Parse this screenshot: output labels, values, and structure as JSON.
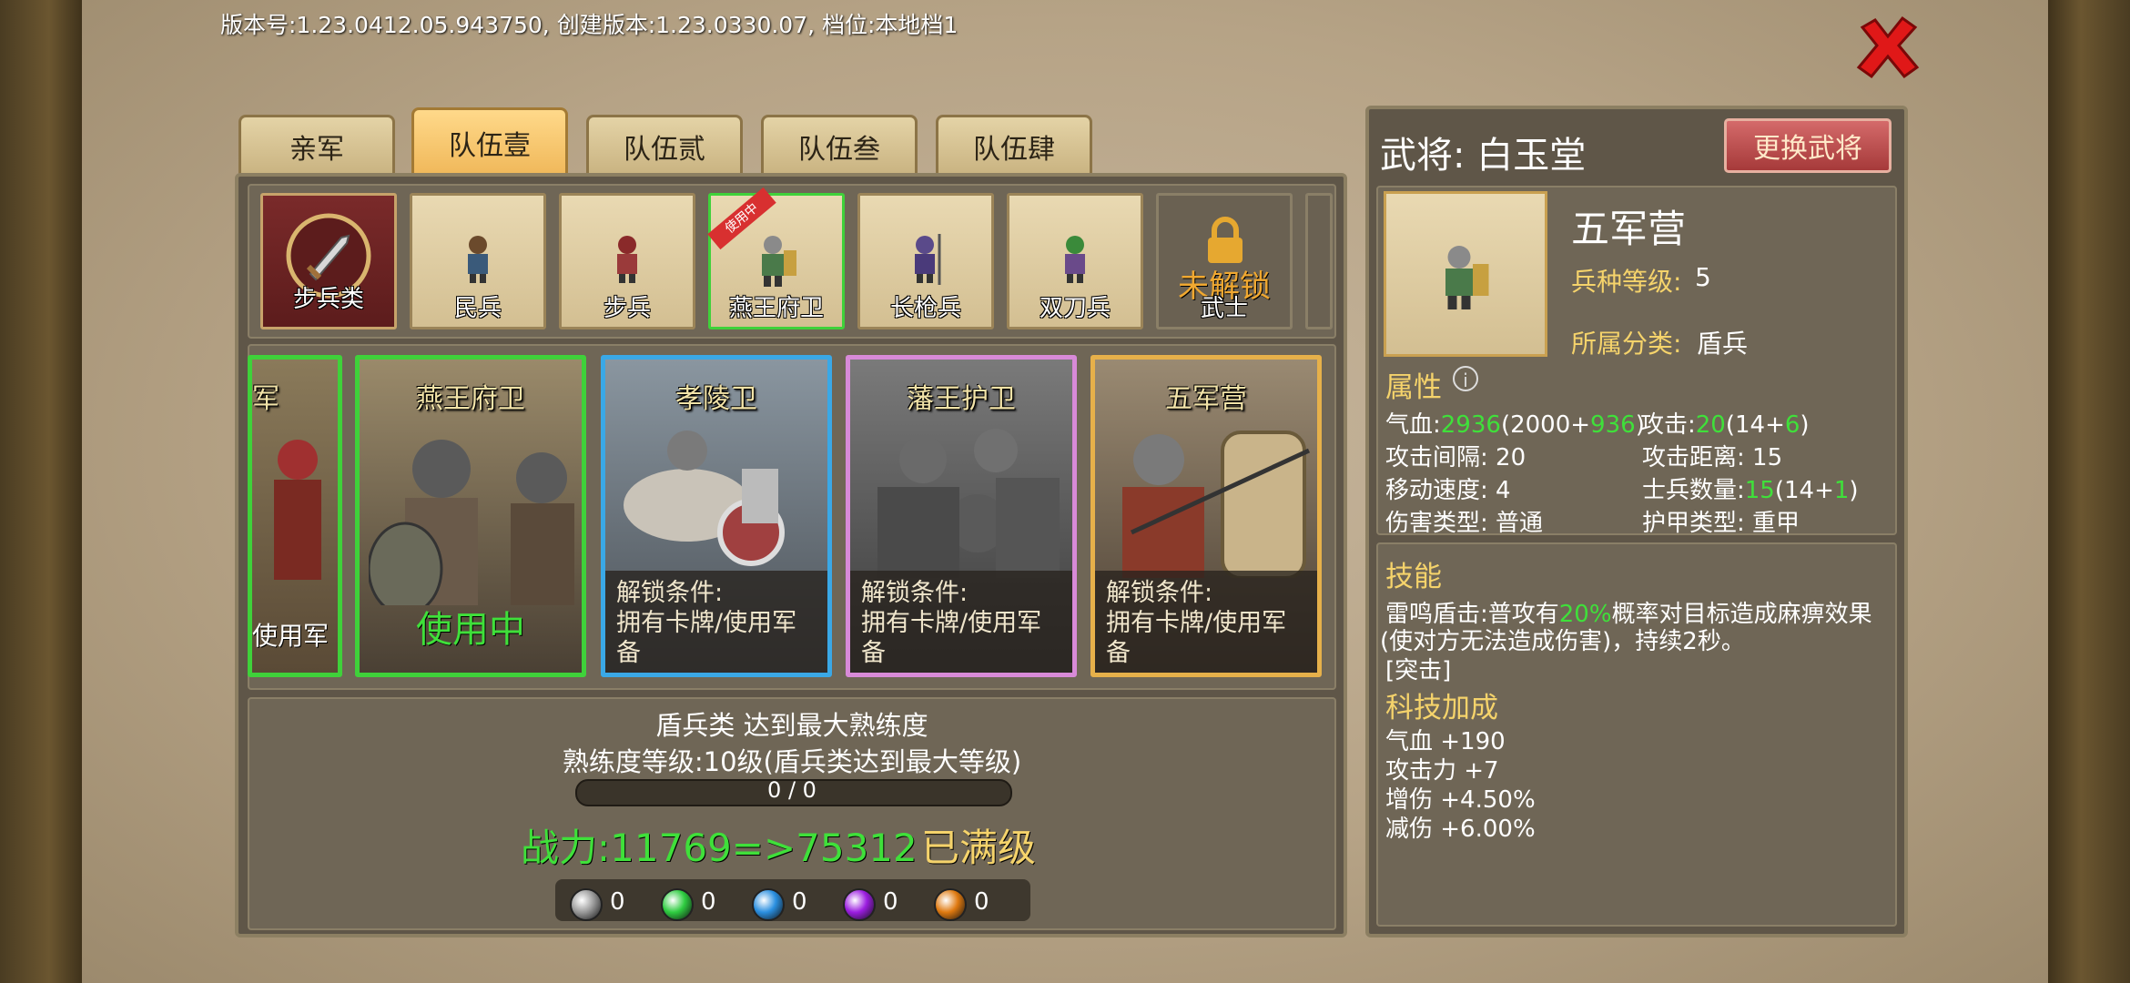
{
  "version_text": "版本号:1.23.0412.05.943750, 创建版本:1.23.0330.07, 档位:本地档1",
  "tabs": [
    "亲军",
    "队伍壹",
    "队伍贰",
    "队伍叁",
    "队伍肆"
  ],
  "active_tab": "队伍壹",
  "unit_slots": [
    {
      "label": "步兵类"
    },
    {
      "label": "民兵"
    },
    {
      "label": "步兵"
    },
    {
      "label": "燕王府卫",
      "ribbon": "使用中"
    },
    {
      "label": "长枪兵"
    },
    {
      "label": "双刀兵"
    },
    {
      "label": "武士",
      "locked_text": "未解锁"
    }
  ],
  "cards": [
    {
      "title": "军",
      "bottom": "使用军"
    },
    {
      "title": "燕王府卫",
      "status": "使用中"
    },
    {
      "title": "孝陵卫",
      "unlock_label": "解锁条件:",
      "unlock_text": "拥有卡牌/使用军备"
    },
    {
      "title": "藩王护卫",
      "unlock_label": "解锁条件:",
      "unlock_text": "拥有卡牌/使用军备"
    },
    {
      "title": "五军营",
      "unlock_label": "解锁条件:",
      "unlock_text": "拥有卡牌/使用军备"
    }
  ],
  "proficiency": {
    "title": "盾兵类 达到最大熟练度",
    "level": "熟练度等级:10级(盾兵类达到最大等级)",
    "progress_text": "0 / 0",
    "power": "战力:11769=>75312",
    "max_level": "已满级"
  },
  "gems": [
    {
      "color": "#9a9a9a",
      "count": "0"
    },
    {
      "color": "#2ecc40",
      "count": "0"
    },
    {
      "color": "#2a8fe0",
      "count": "0"
    },
    {
      "color": "#9b1de0",
      "count": "0"
    },
    {
      "color": "#e07a10",
      "count": "0"
    }
  ],
  "general": {
    "label": "武将: 白玉堂",
    "change_button": "更换武将"
  },
  "unit_info": {
    "name": "五军营",
    "level_label": "兵种等级:",
    "level_value": "5",
    "category_label": "所属分类:",
    "category_value": "盾兵"
  },
  "attributes": {
    "heading": "属性",
    "hp_label": "气血:",
    "hp_total": "2936",
    "hp_base": "(2000+",
    "hp_bonus": "936",
    "hp_close": ")",
    "atk_label": "攻击:",
    "atk_total": "20",
    "atk_base": "(14+",
    "atk_bonus": "6",
    "atk_close": ")",
    "interval": "攻击间隔: 20",
    "range": "攻击距离: 15",
    "speed": "移动速度: 4",
    "soldier_label": "士兵数量:",
    "soldier_total": "15",
    "soldier_base": "(14+",
    "soldier_bonus": "1",
    "soldier_close": ")",
    "damage_type": "伤害类型: 普通",
    "armor_type": "护甲类型: 重甲"
  },
  "skills": {
    "heading": "技能",
    "desc_part1": "雷鸣盾击:普攻有",
    "desc_pct": "20%",
    "desc_part2": "概率对目标造成麻痹效果",
    "desc_line2": "(使对方无法造成伤害)，持续2秒。",
    "tag": "[突击]"
  },
  "tech": {
    "heading": "科技加成",
    "lines": [
      "气血 +190",
      "攻击力 +7",
      "增伤 +4.50%",
      "减伤 +6.00%"
    ]
  }
}
